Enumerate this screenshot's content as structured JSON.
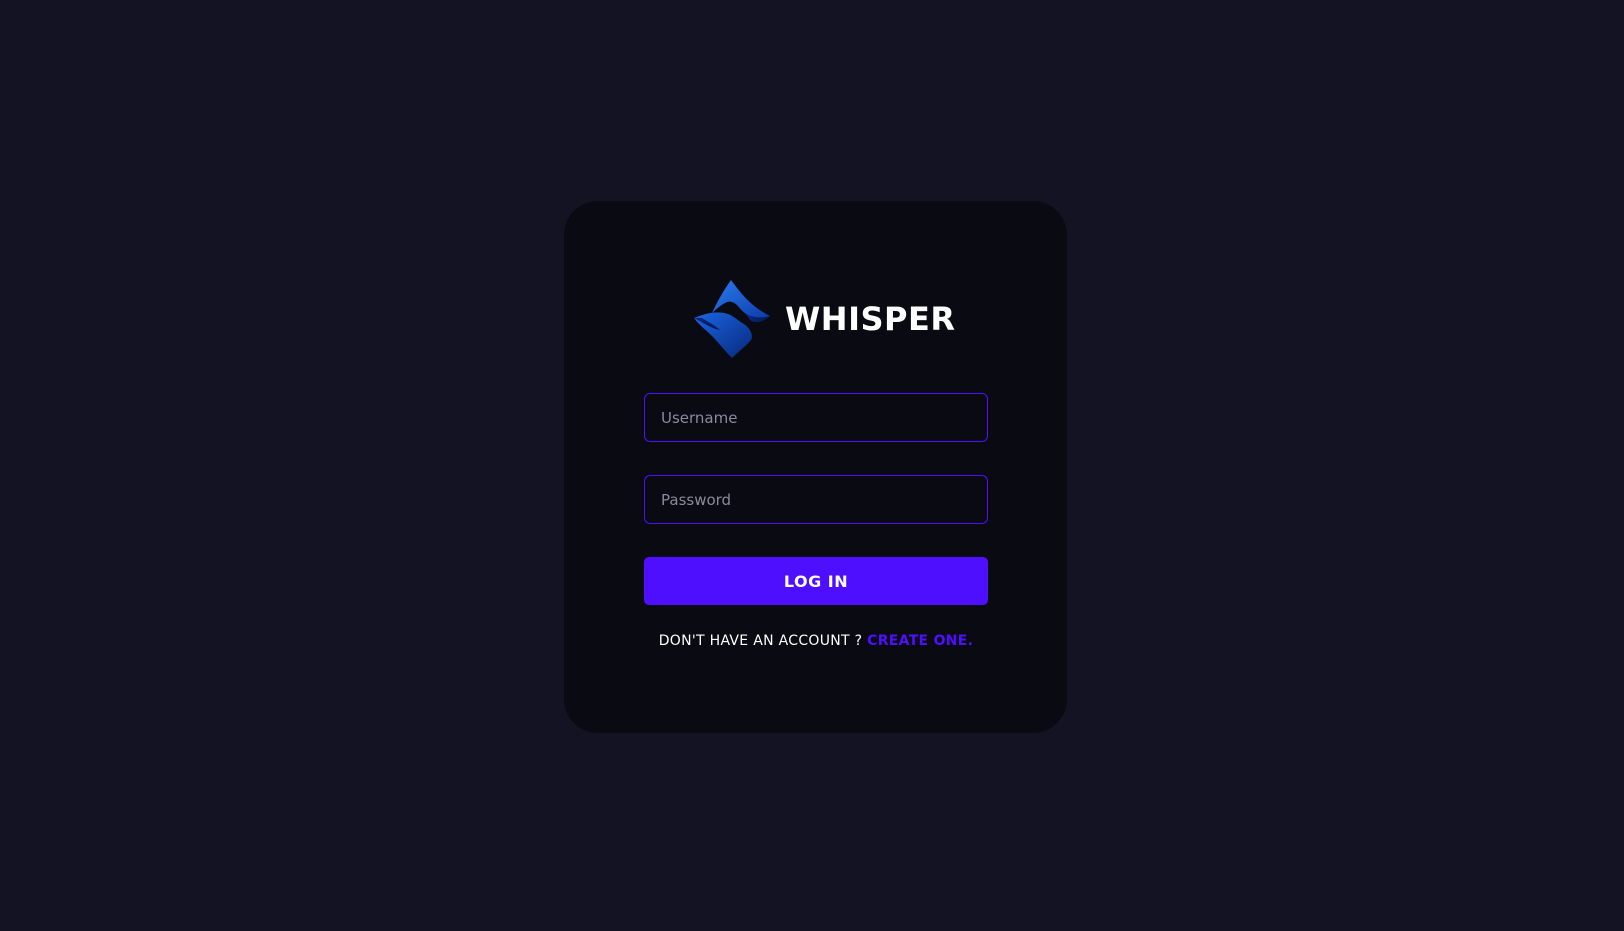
{
  "app": {
    "name": "WHISPER",
    "logo_icon": "whisper-logo-icon"
  },
  "form": {
    "username": {
      "placeholder": "Username",
      "value": ""
    },
    "password": {
      "placeholder": "Password",
      "value": ""
    },
    "submit_label": "LOG IN"
  },
  "signup": {
    "prompt": "DON'T HAVE AN ACCOUNT ? ",
    "link_label": "CREATE ONE."
  },
  "colors": {
    "page_background": "#131324",
    "card_background": "#0a0a12",
    "accent": "#4e0eff",
    "logo_blue": "#1d5ddb",
    "text": "#ffffff"
  }
}
